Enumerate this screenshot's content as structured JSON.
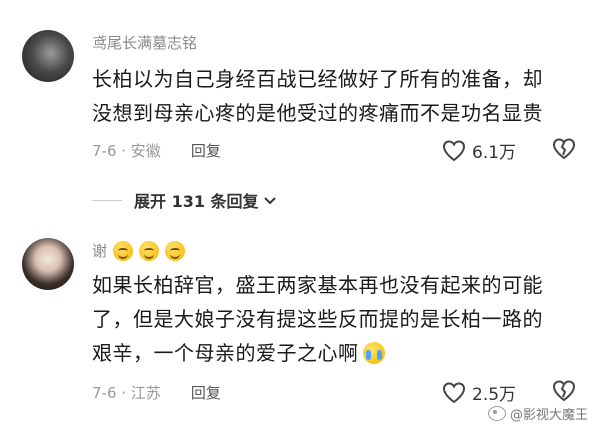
{
  "comments": [
    {
      "username": "鸢尾长满墓志铭",
      "text_lines": [
        "长柏以为自己身经百战已经做好了所有的准备，却",
        "没想到母亲心疼的是他受过的疼痛而不是功名显贵"
      ],
      "date_location": "7-6 · 安徽",
      "reply_label": "回复",
      "likes": "6.1万"
    },
    {
      "username": "谢",
      "text_lines": [
        "如果长柏辞官，盛王两家基本再也没有起来的可能",
        "了，但是大娘子没有提这些反而提的是长柏一路的",
        "艰辛，一个母亲的爱子之心啊"
      ],
      "date_location": "7-6 · 江苏",
      "reply_label": "回复",
      "likes": "2.5万"
    }
  ],
  "expand_replies": "展开 131 条回复",
  "watermark": "@影视大魔王",
  "colors": {
    "meta": "#999999",
    "text": "#1a1a1a",
    "username": "#8a8a8a"
  }
}
